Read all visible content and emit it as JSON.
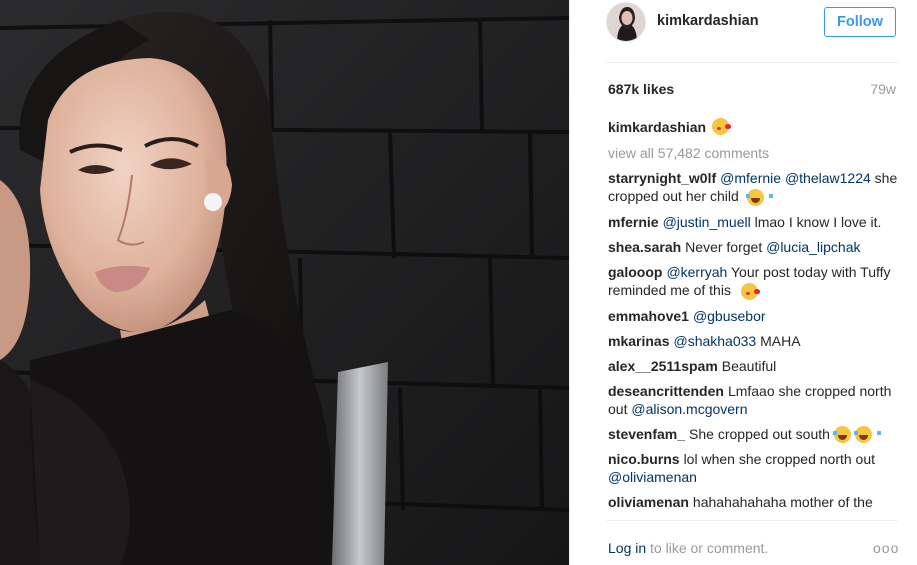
{
  "post": {
    "username": "kimkardashian",
    "follow_label": "Follow",
    "likes": "687k likes",
    "time_ago": "79w",
    "caption_user": "kimkardashian",
    "view_all": "view all 57,482 comments"
  },
  "comments": [
    {
      "user": "starrynight_w0lf",
      "parts": [
        {
          "t": "mention",
          "v": "@mfernie"
        },
        {
          "t": "text",
          "v": " "
        },
        {
          "t": "mention",
          "v": "@thelaw1224"
        },
        {
          "t": "text",
          "v": " she cropped out her child "
        }
      ],
      "emoji": [
        "laugh"
      ]
    },
    {
      "user": "mfernie",
      "parts": [
        {
          "t": "mention",
          "v": "@justin_muell"
        },
        {
          "t": "text",
          "v": " lmao I know I love it."
        }
      ],
      "emoji": []
    },
    {
      "user": "shea.sarah",
      "parts": [
        {
          "t": "text",
          "v": "Never forget "
        },
        {
          "t": "mention",
          "v": "@lucia_lipchak"
        }
      ],
      "emoji": []
    },
    {
      "user": "galooop",
      "parts": [
        {
          "t": "mention",
          "v": "@kerryah"
        },
        {
          "t": "text",
          "v": " Your post today with Tuffy reminded me of this "
        }
      ],
      "emoji": [
        "kiss"
      ]
    },
    {
      "user": "emmahove1",
      "parts": [
        {
          "t": "mention",
          "v": "@gbusebor"
        }
      ],
      "emoji": []
    },
    {
      "user": "mkarinas",
      "parts": [
        {
          "t": "mention",
          "v": "@shakha033"
        },
        {
          "t": "text",
          "v": " MAHA"
        }
      ],
      "emoji": []
    },
    {
      "user": "alex__2511spam",
      "parts": [
        {
          "t": "text",
          "v": "Beautiful"
        }
      ],
      "emoji": []
    },
    {
      "user": "deseancrittenden",
      "parts": [
        {
          "t": "text",
          "v": "Lmfaao she cropped north out "
        },
        {
          "t": "mention",
          "v": "@alison.mcgovern"
        }
      ],
      "emoji": []
    },
    {
      "user": "stevenfam_",
      "parts": [
        {
          "t": "text",
          "v": "She cropped out south"
        }
      ],
      "emoji": [
        "laugh",
        "laugh"
      ]
    },
    {
      "user": "nico.burns",
      "parts": [
        {
          "t": "text",
          "v": "lol when she cropped north out "
        },
        {
          "t": "mention",
          "v": "@oliviamenan"
        }
      ],
      "emoji": []
    },
    {
      "user": "oliviamenan",
      "parts": [
        {
          "t": "text",
          "v": "hahahahahaha mother of the"
        }
      ],
      "emoji": []
    }
  ],
  "footer": {
    "login_label": "Log in",
    "login_suffix": " to like or comment.",
    "more_label": "ooo"
  },
  "icons": {
    "caption_emoji": "kiss-emoji-icon",
    "more": "more-options-icon"
  },
  "colors": {
    "accent": "#3897f0",
    "mention": "#003569",
    "muted": "#999999",
    "text": "#262626"
  }
}
